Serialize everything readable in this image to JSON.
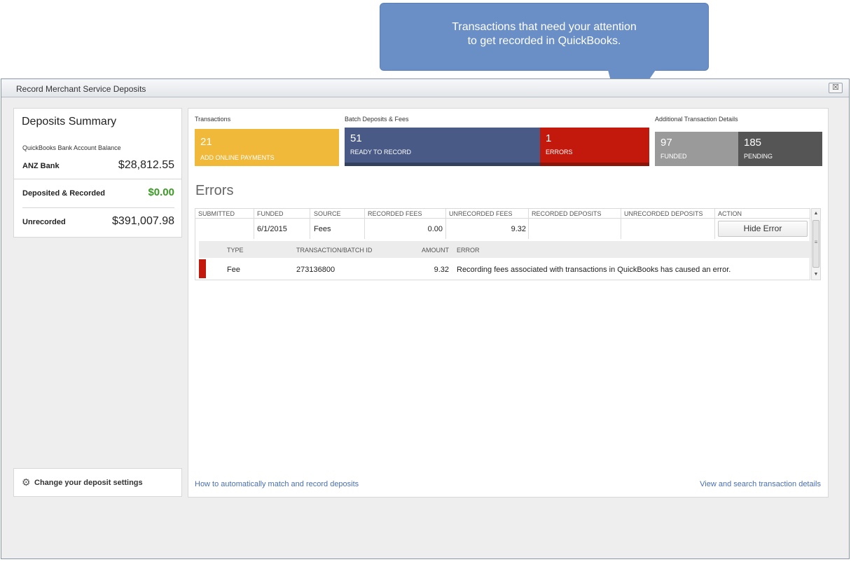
{
  "callout": {
    "line1": "Transactions that need your attention",
    "line2": "to get recorded in QuickBooks."
  },
  "window": {
    "title": "Record Merchant Service Deposits",
    "close_glyph": "☒"
  },
  "summary": {
    "title": "Deposits Summary",
    "balance_label": "QuickBooks Bank Account Balance",
    "bank_name": "ANZ Bank",
    "bank_balance": "$28,812.55",
    "deposited_label": "Deposited & Recorded",
    "deposited_value": "$0.00",
    "unrecorded_label": "Unrecorded",
    "unrecorded_value": "$391,007.98"
  },
  "settings": {
    "label": "Change your deposit settings"
  },
  "sections": {
    "transactions": "Transactions",
    "batch": "Batch Deposits & Fees",
    "additional": "Additional Transaction Details"
  },
  "tiles": {
    "online": {
      "count": "21",
      "caption": "ADD ONLINE PAYMENTS"
    },
    "ready": {
      "count": "51",
      "caption": "READY TO RECORD"
    },
    "errors": {
      "count": "1",
      "caption": "ERRORS"
    },
    "funded": {
      "count": "97",
      "caption": "FUNDED"
    },
    "pending": {
      "count": "185",
      "caption": "PENDING"
    }
  },
  "errors": {
    "title": "Errors",
    "columns": [
      "SUBMITTED",
      "FUNDED",
      "SOURCE",
      "RECORDED FEES",
      "UNRECORDED FEES",
      "RECORDED DEPOSITS",
      "UNRECORDED DEPOSITS",
      "ACTION"
    ],
    "row": {
      "submitted": "",
      "funded": "6/1/2015",
      "source": "Fees",
      "recorded_fees": "0.00",
      "unrecorded_fees": "9.32",
      "recorded_deposits": "",
      "unrecorded_deposits": "",
      "action_label": "Hide Error"
    },
    "detail_columns": [
      "TYPE",
      "TRANSACTION/BATCH ID",
      "AMOUNT",
      "ERROR"
    ],
    "detail_row": {
      "type": "Fee",
      "batch_id": "273136800",
      "amount": "9.32",
      "error": "Recording fees associated with transactions in QuickBooks has caused an error."
    }
  },
  "links": {
    "match": "How to automatically match and record deposits",
    "view": "View and search transaction details"
  },
  "colors": {
    "online": "#f0b93a",
    "ready": "#4a5a86",
    "errors": "#c3180c",
    "funded": "#9a9a9a",
    "pending": "#555555",
    "callout": "#6a8ec6",
    "link": "#4a6fb2",
    "deposited": "#3a9b22"
  }
}
